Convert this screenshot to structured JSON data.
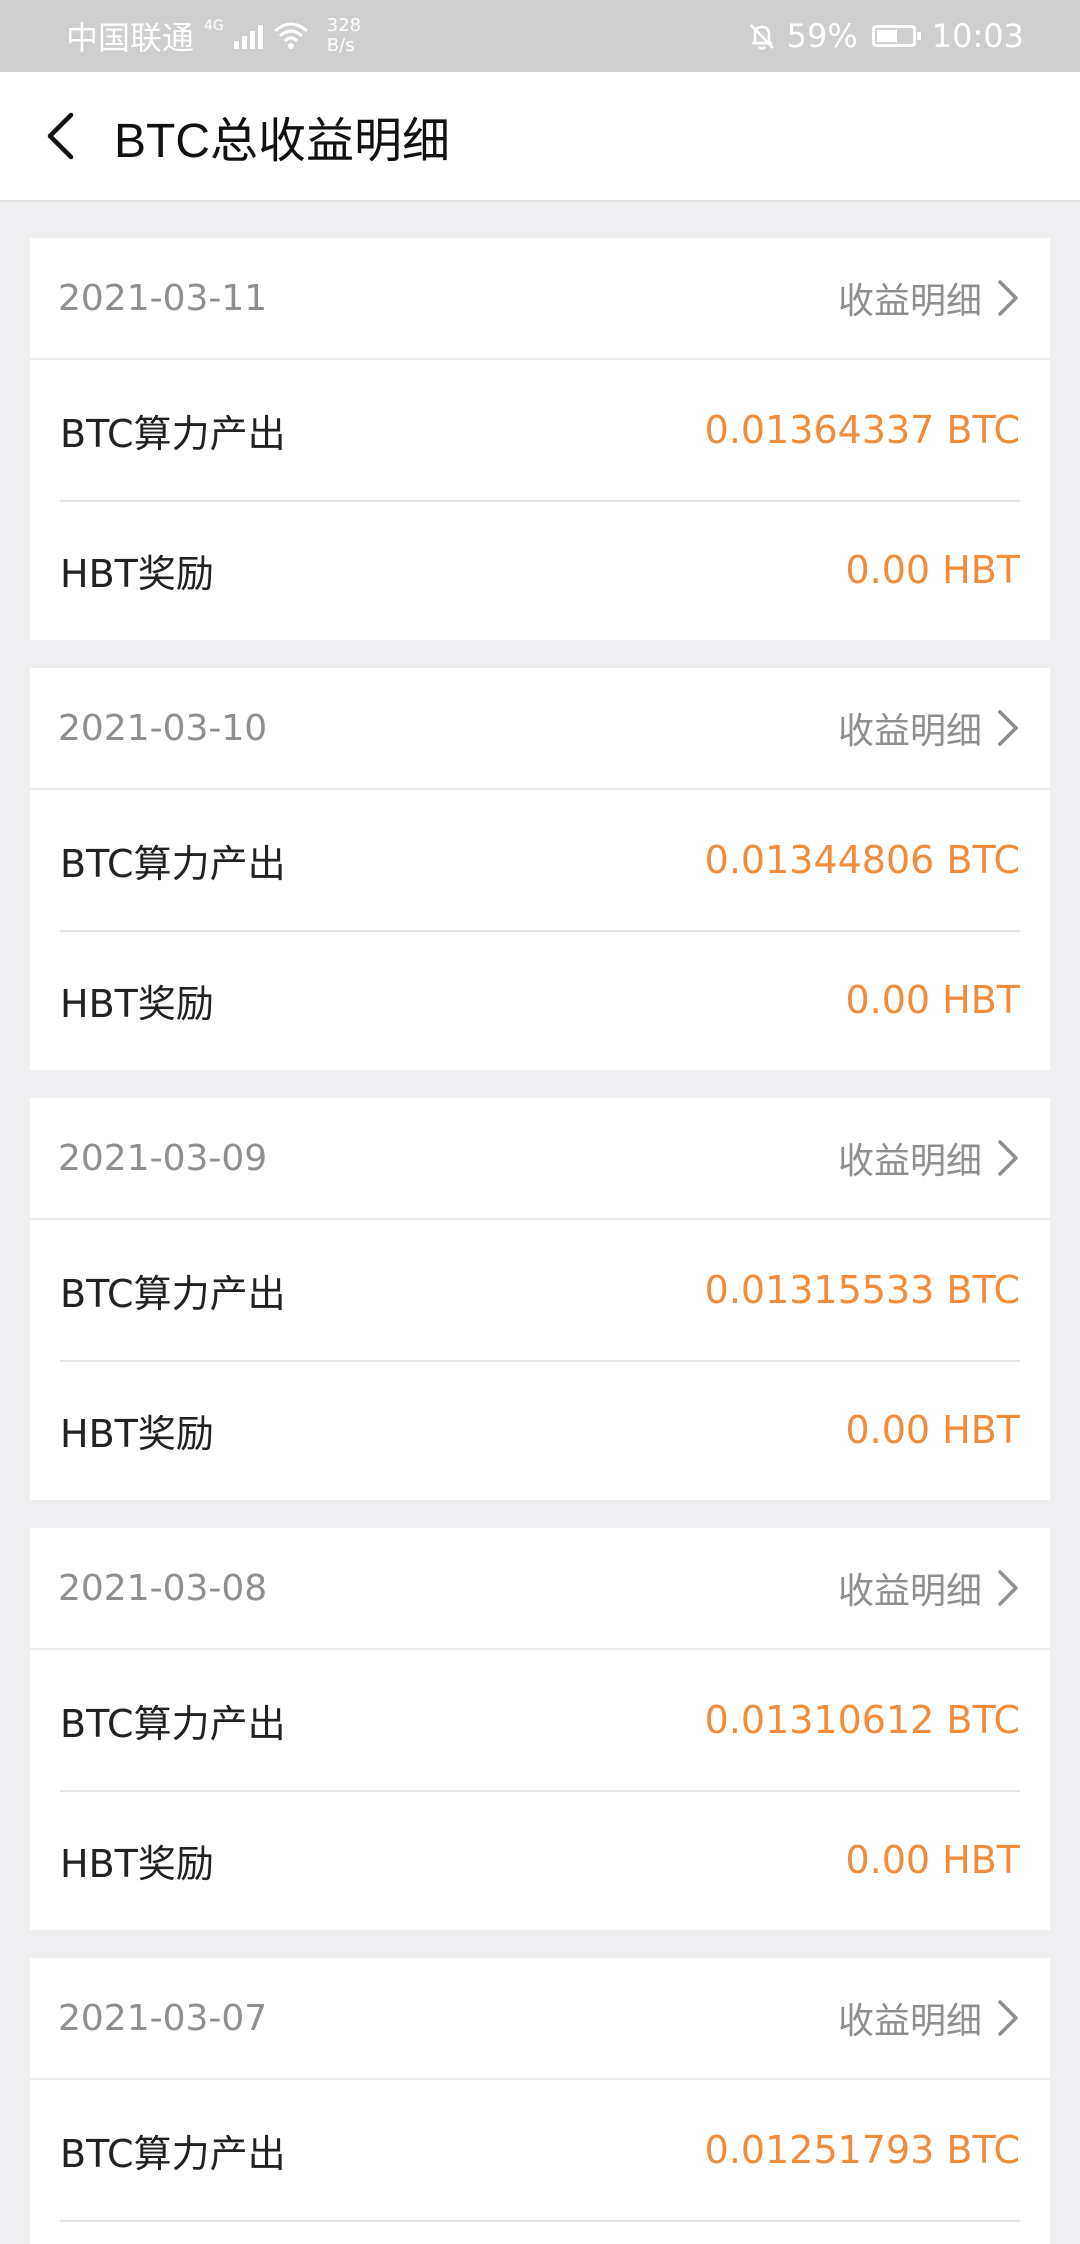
{
  "status_bar": {
    "carrier": "中国联通",
    "network": "4G",
    "speed_top": "328",
    "speed_bottom": "B/s",
    "battery_percent": "59%",
    "battery_level": 0.59,
    "time": "10:03"
  },
  "header": {
    "title": "BTC总收益明细"
  },
  "colors": {
    "accent": "#f08c3c",
    "muted": "#8f8f8f",
    "background": "#efeff1"
  },
  "cards": [
    {
      "date": "2021-03-11",
      "detail_label": "收益明细",
      "rows": [
        {
          "label": "BTC算力产出",
          "value": "0.01364337 BTC"
        },
        {
          "label": "HBT奖励",
          "value": "0.00 HBT"
        }
      ]
    },
    {
      "date": "2021-03-10",
      "detail_label": "收益明细",
      "rows": [
        {
          "label": "BTC算力产出",
          "value": "0.01344806 BTC"
        },
        {
          "label": "HBT奖励",
          "value": "0.00 HBT"
        }
      ]
    },
    {
      "date": "2021-03-09",
      "detail_label": "收益明细",
      "rows": [
        {
          "label": "BTC算力产出",
          "value": "0.01315533 BTC"
        },
        {
          "label": "HBT奖励",
          "value": "0.00 HBT"
        }
      ]
    },
    {
      "date": "2021-03-08",
      "detail_label": "收益明细",
      "rows": [
        {
          "label": "BTC算力产出",
          "value": "0.01310612 BTC"
        },
        {
          "label": "HBT奖励",
          "value": "0.00 HBT"
        }
      ]
    },
    {
      "date": "2021-03-07",
      "detail_label": "收益明细",
      "rows": [
        {
          "label": "BTC算力产出",
          "value": "0.01251793 BTC"
        }
      ]
    }
  ]
}
